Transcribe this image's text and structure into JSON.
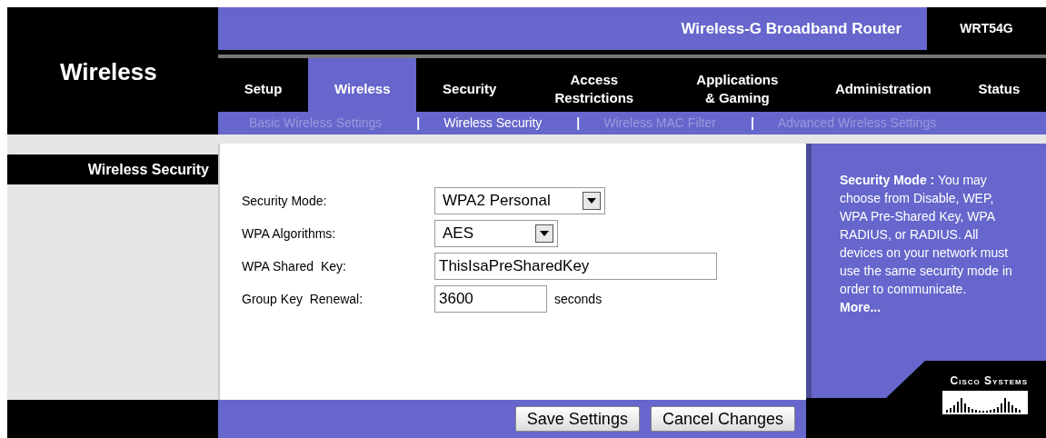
{
  "header": {
    "section_title": "Wireless",
    "product_name": "Wireless-G Broadband Router",
    "model": "WRT54G"
  },
  "tabs": [
    {
      "label": "Setup",
      "selected": false
    },
    {
      "label": "Wireless",
      "selected": true
    },
    {
      "label": "Security",
      "selected": false
    },
    {
      "label": "Access Restrictions",
      "selected": false
    },
    {
      "label": "Applications & Gaming",
      "selected": false
    },
    {
      "label": "Administration",
      "selected": false
    },
    {
      "label": "Status",
      "selected": false
    }
  ],
  "subtabs": [
    {
      "label": "Basic Wireless Settings",
      "selected": false
    },
    {
      "separator": "|",
      "label": "Wireless Security",
      "selected": true
    },
    {
      "separator": "|",
      "label": "Wireless MAC Filter",
      "selected": false
    },
    {
      "separator": "|",
      "label": "Advanced Wireless Settings",
      "selected": false
    }
  ],
  "sidebar": {
    "heading": "Wireless Security"
  },
  "form": {
    "fields": [
      {
        "kind": "select",
        "label": "Security Mode:",
        "value": "WPA2 Personal"
      },
      {
        "kind": "select",
        "label": "WPA Algorithms:",
        "value": "AES"
      },
      {
        "kind": "text",
        "label": "WPA Shared  Key:",
        "value": "ThisIsaPreSharedKey"
      },
      {
        "kind": "text",
        "label": "Group Key  Renewal:",
        "value": "3600",
        "unit": "seconds"
      }
    ]
  },
  "help": {
    "text": "**Security Mode :** You may choose from Disable, WEP, WPA Pre-Shared Key, WPA RADIUS, or RADIUS. All devices on your network must use the same security mode in order to communicate.",
    "link": "More..."
  },
  "buttons": [
    "Save Settings",
    "Cancel Changes"
  ],
  "logo": {
    "text": "Cisco Systems"
  }
}
